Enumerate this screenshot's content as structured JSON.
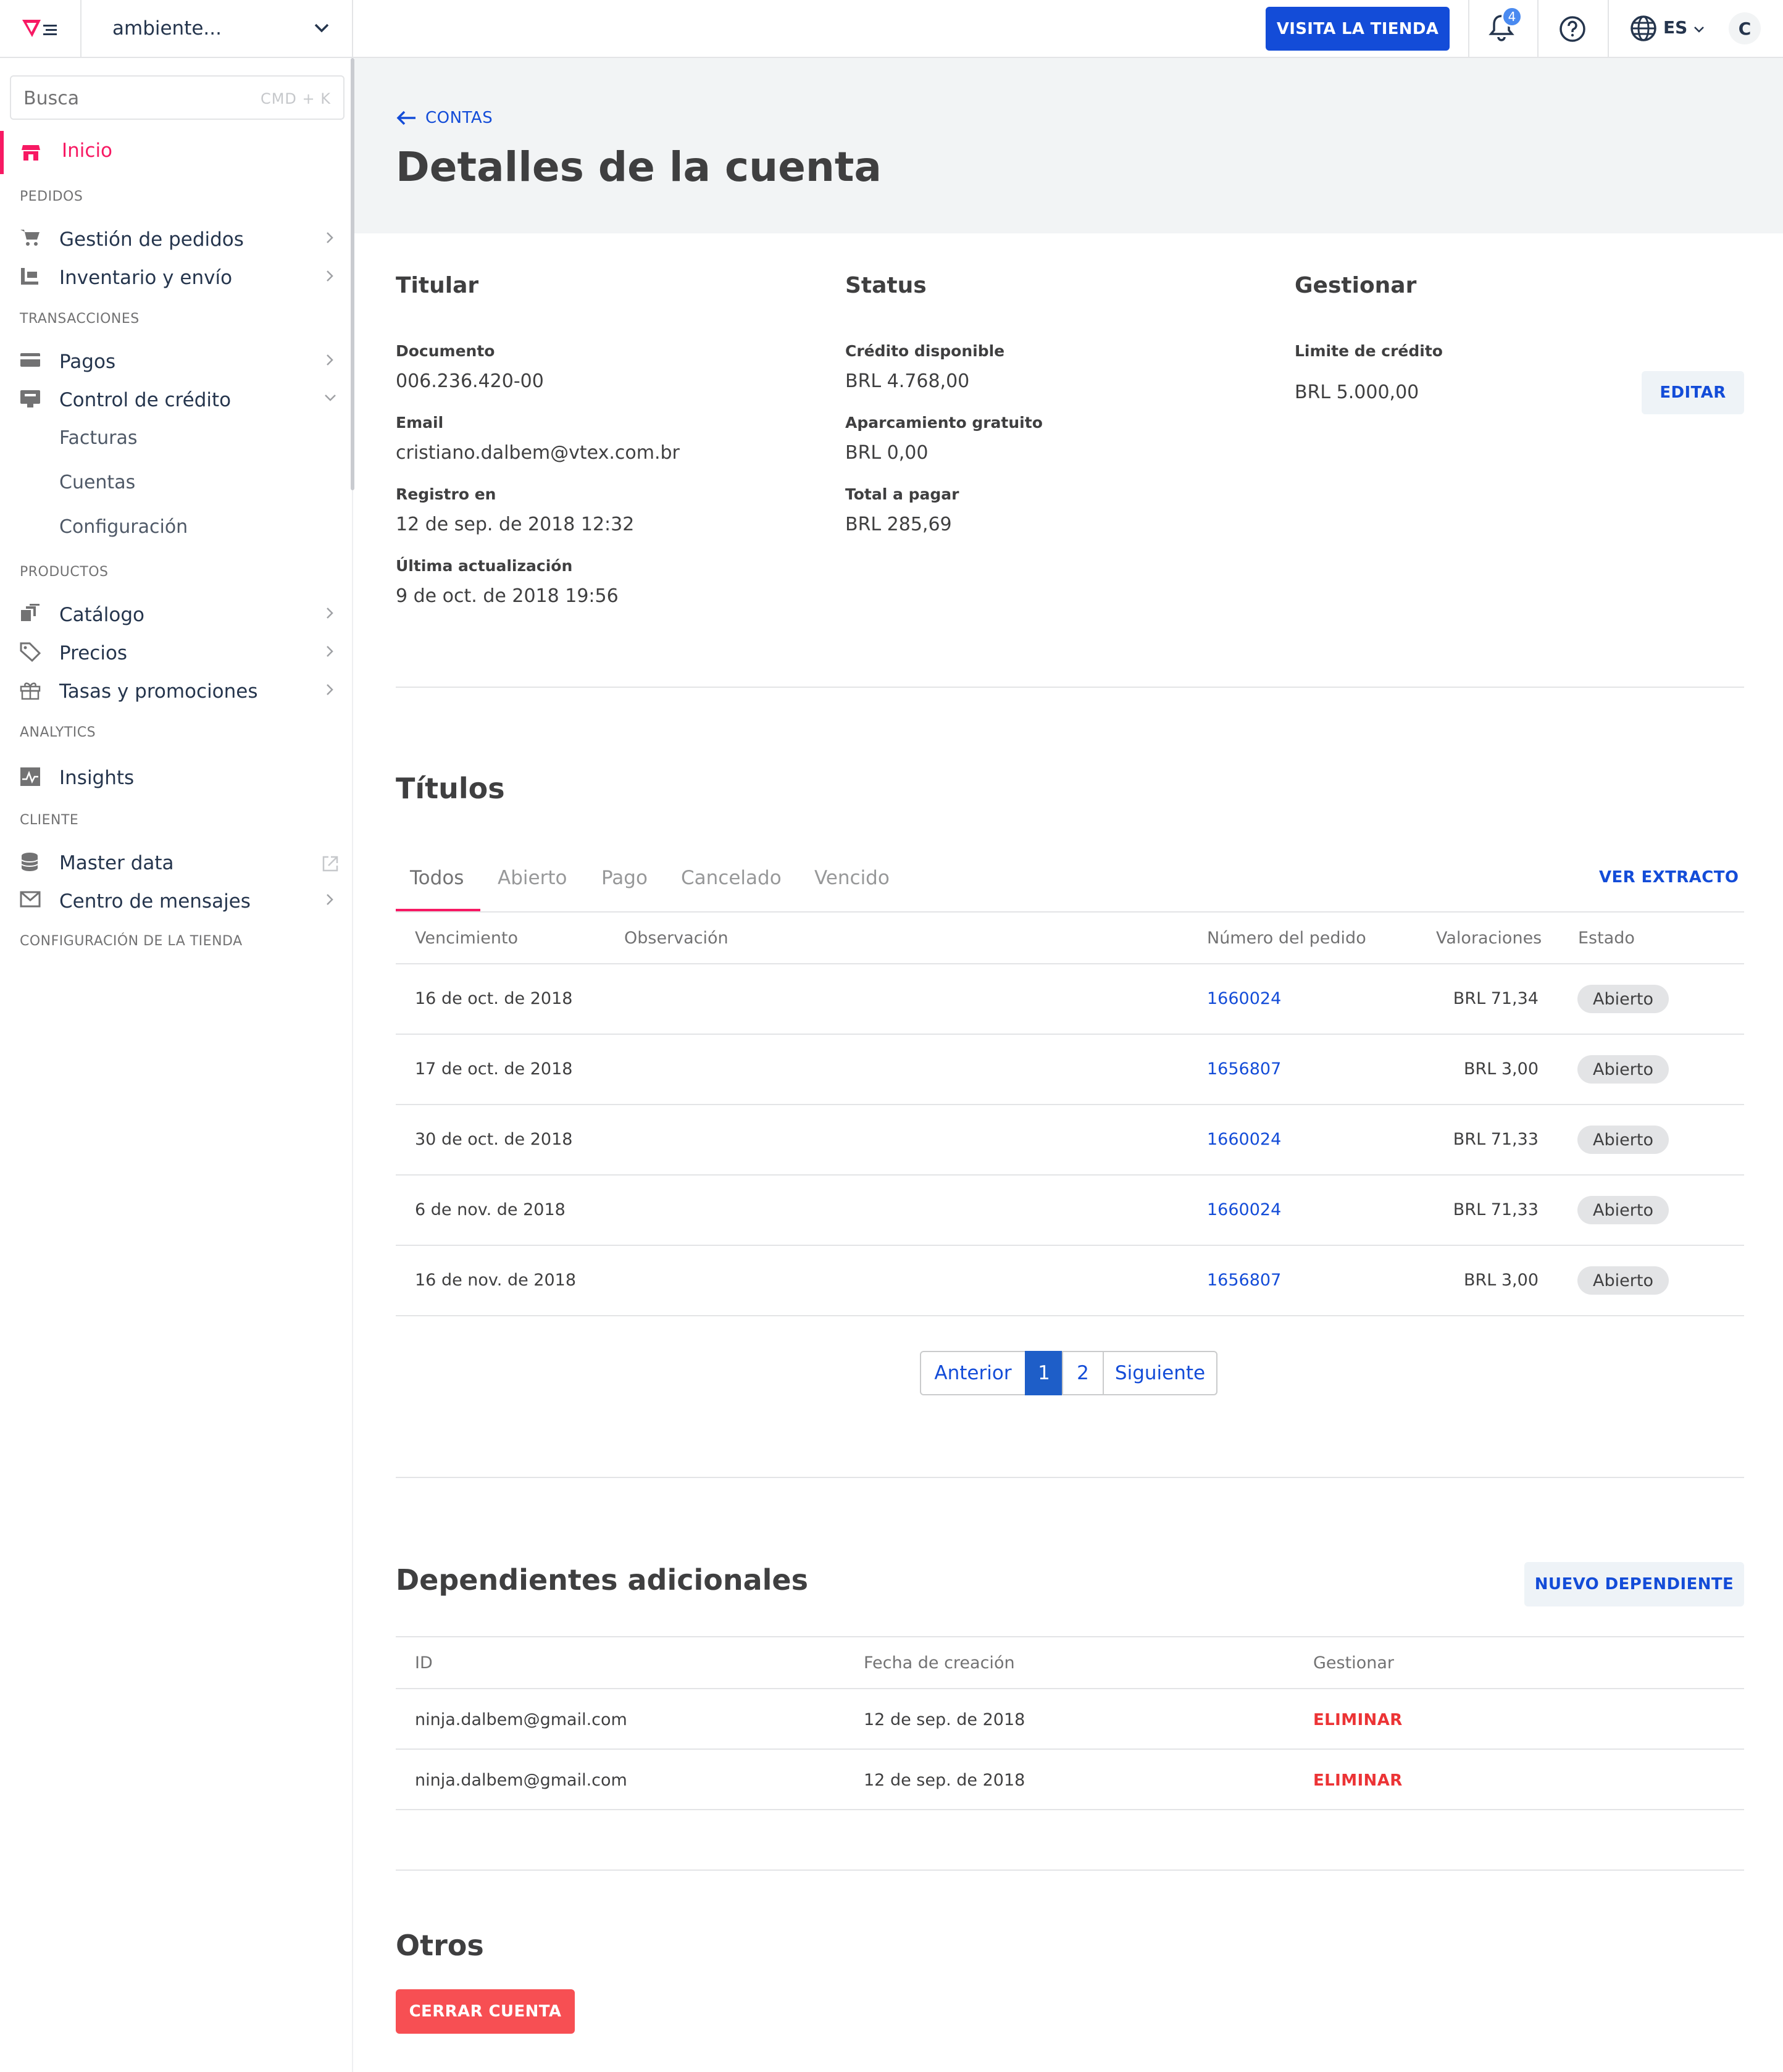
{
  "topbar": {
    "account": "ambiente...",
    "visit_store": "VISITA LA TIENDA",
    "notifications": "4",
    "lang": "ES",
    "avatar": "C"
  },
  "sidebar": {
    "search_placeholder": "Busca",
    "search_shortcut": "CMD + K",
    "home": "Inicio",
    "sections": {
      "pedidos": "PEDIDOS",
      "transacciones": "TRANSACCIONES",
      "productos": "PRODUCTOS",
      "analytics": "ANALYTICS",
      "cliente": "CLIENTE",
      "config": "CONFIGURACIÓN DE LA TIENDA"
    },
    "items": {
      "orders": "Gestión de pedidos",
      "inventory": "Inventario y envío",
      "payments": "Pagos",
      "credit": "Control de crédito",
      "invoices": "Facturas",
      "accounts": "Cuentas",
      "settings": "Configuración",
      "catalog": "Catálogo",
      "prices": "Precios",
      "promotions": "Tasas y promociones",
      "insights": "Insights",
      "masterdata": "Master data",
      "messages": "Centro de mensajes"
    }
  },
  "header": {
    "back": "CONTAS",
    "title": "Detalles de la cuenta"
  },
  "holder": {
    "title": "Titular",
    "doc_label": "Documento",
    "doc": "006.236.420-00",
    "email_label": "Email",
    "email": "cristiano.dalbem@vtex.com.br",
    "reg_label": "Registro en",
    "reg": "12 de sep. de 2018 12:32",
    "upd_label": "Última actualización",
    "upd": "9 de oct. de 2018 19:56"
  },
  "status": {
    "title": "Status",
    "avail_label": "Crédito disponible",
    "avail": "BRL 4.768,00",
    "grace_label": "Aparcamiento gratuito",
    "grace": "BRL 0,00",
    "total_label": "Total a pagar",
    "total": "BRL 285,69"
  },
  "manage": {
    "title": "Gestionar",
    "limit_label": "Limite de crédito",
    "limit": "BRL 5.000,00",
    "edit": "EDITAR"
  },
  "titles": {
    "title": "Títulos",
    "tabs": [
      "Todos",
      "Abierto",
      "Pago",
      "Cancelado",
      "Vencido"
    ],
    "statement": "VER EXTRACTO",
    "headers": {
      "due": "Vencimiento",
      "obs": "Observación",
      "order": "Número del pedido",
      "value": "Valoraciones",
      "status": "Estado"
    },
    "rows": [
      {
        "due": "16 de oct. de 2018",
        "order": "1660024",
        "value": "BRL 71,34",
        "status": "Abierto"
      },
      {
        "due": "17 de oct. de 2018",
        "order": "1656807",
        "value": "BRL 3,00",
        "status": "Abierto"
      },
      {
        "due": "30 de oct. de 2018",
        "order": "1660024",
        "value": "BRL 71,33",
        "status": "Abierto"
      },
      {
        "due": "6 de nov. de 2018",
        "order": "1660024",
        "value": "BRL 71,33",
        "status": "Abierto"
      },
      {
        "due": "16 de nov. de 2018",
        "order": "1656807",
        "value": "BRL 3,00",
        "status": "Abierto"
      }
    ],
    "pagination": {
      "prev": "Anterior",
      "p1": "1",
      "p2": "2",
      "next": "Siguiente"
    }
  },
  "dependents": {
    "title": "Dependientes adicionales",
    "new": "NUEVO DEPENDIENTE",
    "headers": {
      "id": "ID",
      "date": "Fecha de creación",
      "manage": "Gestionar"
    },
    "rows": [
      {
        "id": "ninja.dalbem@gmail.com",
        "date": "12 de sep. de 2018",
        "action": "ELIMINAR"
      },
      {
        "id": "ninja.dalbem@gmail.com",
        "date": "12 de sep. de 2018",
        "action": "ELIMINAR"
      }
    ]
  },
  "others": {
    "title": "Otros",
    "close": "CERRAR CUENTA"
  },
  "colors": {
    "primary": "#134cd8",
    "accent": "#f71963",
    "danger": "#ec3335"
  }
}
